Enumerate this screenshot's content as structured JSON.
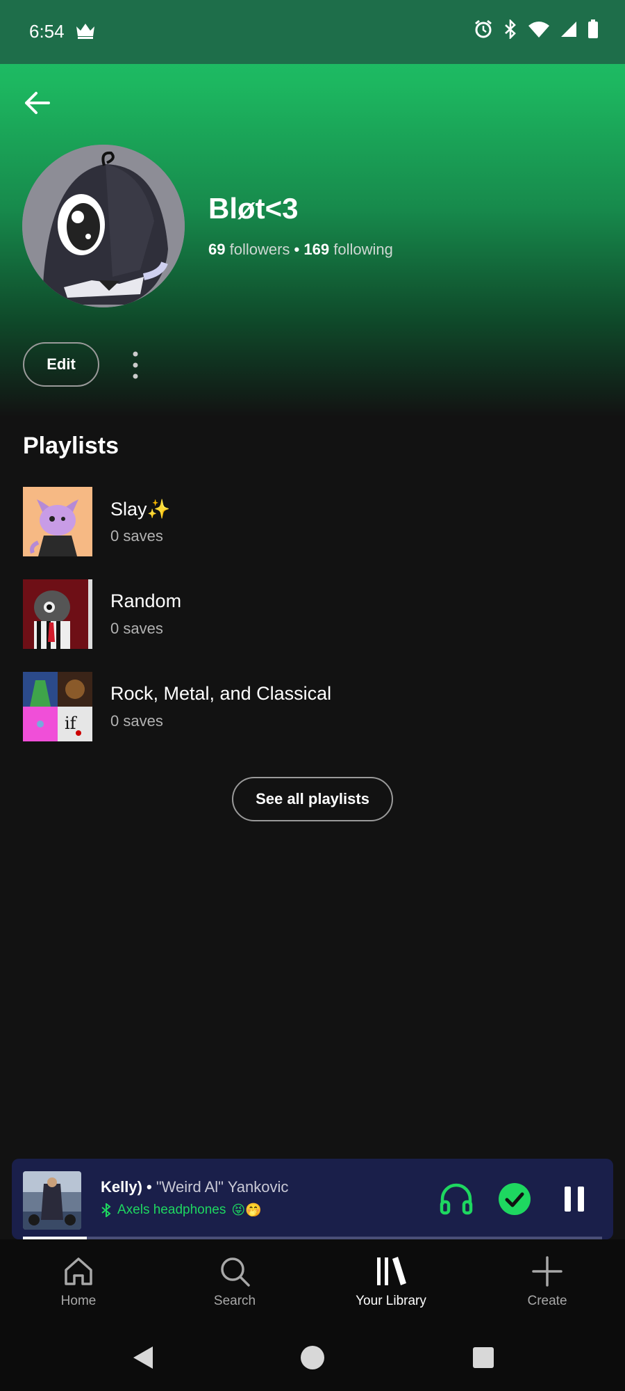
{
  "status_bar": {
    "time": "6:54"
  },
  "profile": {
    "name": "Bløt<3",
    "followers_count": "69",
    "followers_label": "followers",
    "separator": "•",
    "following_count": "169",
    "following_label": "following",
    "edit_label": "Edit"
  },
  "playlists": {
    "title": "Playlists",
    "items": [
      {
        "name": "Slay✨",
        "saves": "0 saves"
      },
      {
        "name": "Random",
        "saves": "0 saves"
      },
      {
        "name": "Rock, Metal, and Classical",
        "saves": "0 saves"
      }
    ],
    "see_all_label": "See all playlists"
  },
  "now_playing": {
    "title_fragment": "Kelly) •",
    "artist": "\"Weird Al\" Yankovic",
    "device": "Axels headphones",
    "device_emoji": "😝🤭",
    "progress": 0.11
  },
  "bottom_nav": {
    "items": [
      {
        "label": "Home",
        "icon": "home-icon"
      },
      {
        "label": "Search",
        "icon": "search-icon"
      },
      {
        "label": "Your Library",
        "icon": "library-icon"
      },
      {
        "label": "Create",
        "icon": "plus-icon"
      }
    ],
    "active": "Your Library"
  },
  "colors": {
    "accent": "#1ed760",
    "background": "#121212",
    "miniplayer_bg": "#1a1f4a"
  }
}
